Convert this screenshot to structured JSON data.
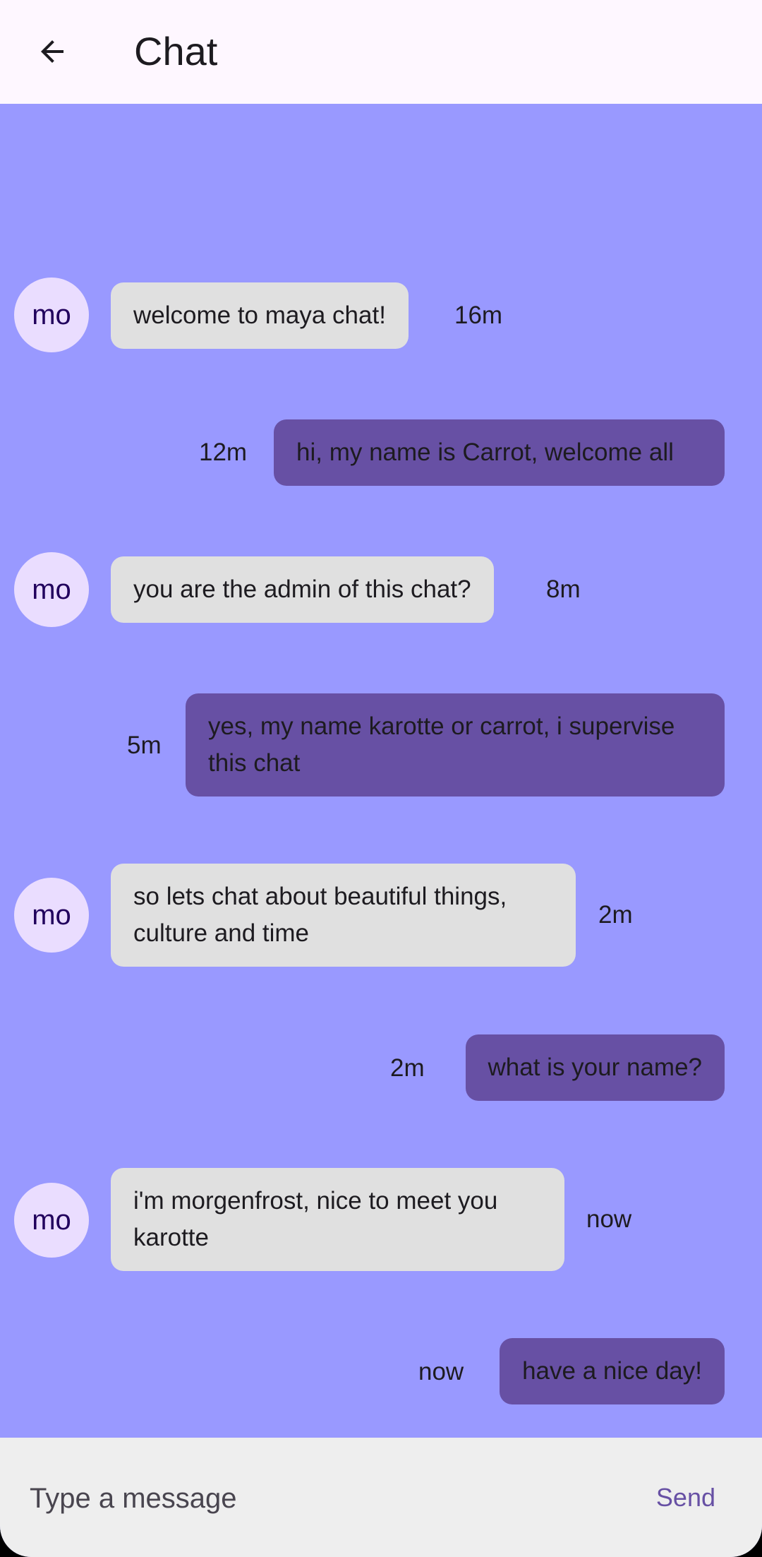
{
  "appbar": {
    "title": "Chat"
  },
  "messages": [
    {
      "side": "in",
      "avatar": "mo",
      "text": "welcome to maya chat!",
      "time": "16m"
    },
    {
      "side": "out",
      "text": "hi, my name is Carrot, welcome all",
      "time": "12m"
    },
    {
      "side": "in",
      "avatar": "mo",
      "text": "you are the admin of this chat?",
      "time": "8m"
    },
    {
      "side": "out",
      "text": "yes, my name karotte or carrot, i supervise this chat",
      "time": "5m"
    },
    {
      "side": "in",
      "avatar": "mo",
      "text": "so lets chat about beautiful things, culture and time",
      "time": "2m"
    },
    {
      "side": "out",
      "text": "what is your name?",
      "time": "2m"
    },
    {
      "side": "in",
      "avatar": "mo",
      "text": "i'm morgenfrost, nice to meet you karotte",
      "time": "now"
    },
    {
      "side": "out",
      "text": "have a nice day!",
      "time": "now"
    }
  ],
  "composer": {
    "placeholder": "Type a message",
    "send_label": "Send"
  },
  "colors": {
    "chat_background": "#9999ff",
    "incoming_bubble": "#e0e0e0",
    "outgoing_bubble": "#6750a4",
    "avatar": "#eaddff",
    "accent": "#6750a4"
  }
}
